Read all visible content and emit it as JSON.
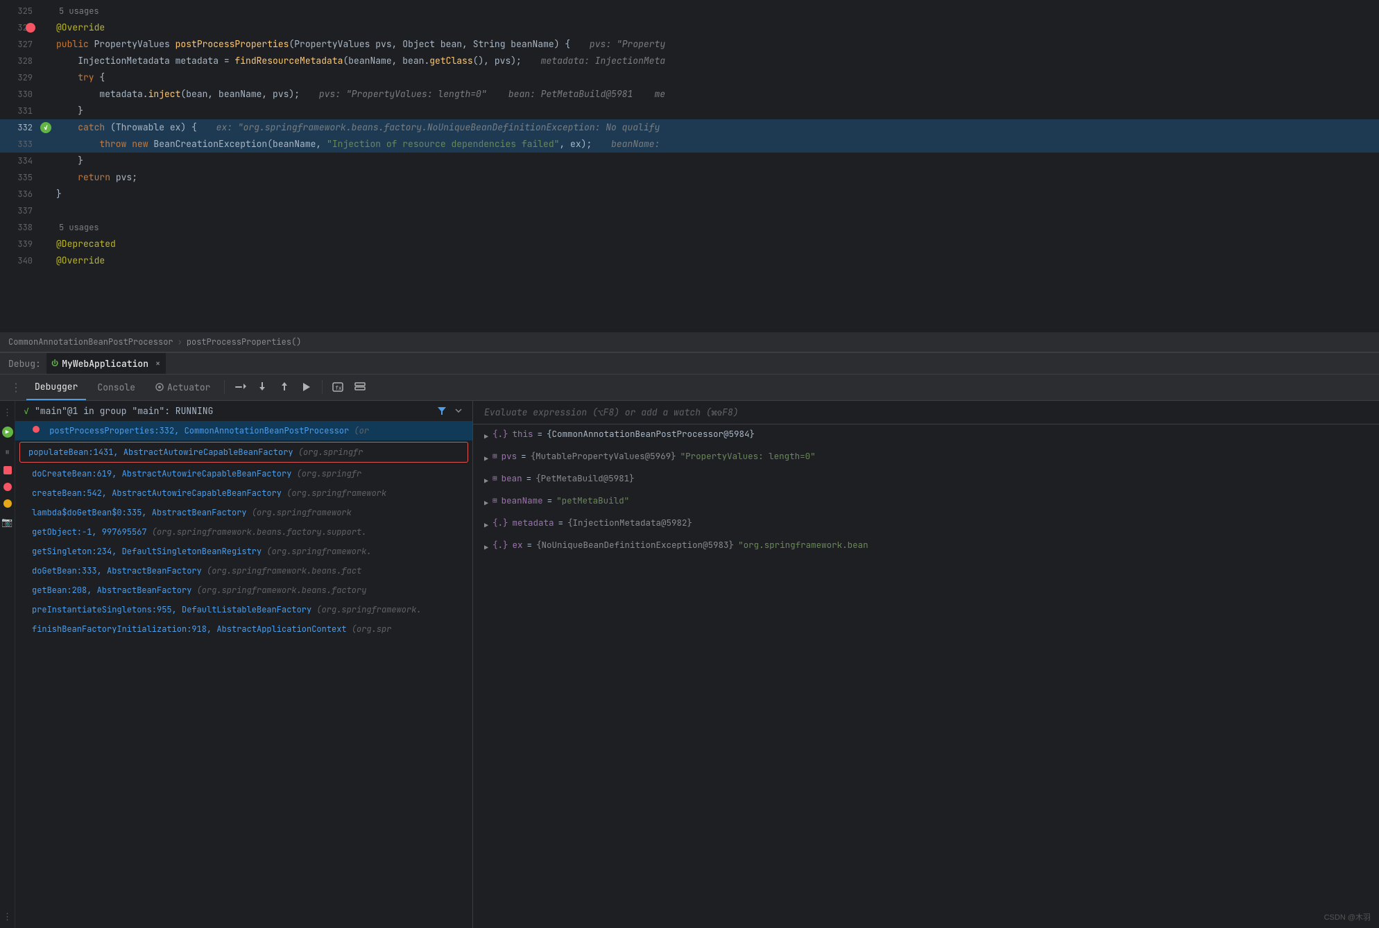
{
  "breadcrumb": {
    "class": "CommonAnnotationBeanPostProcessor",
    "method": "postProcessProperties()"
  },
  "debug_bar": {
    "label": "Debug:",
    "session": "MyWebApplication",
    "close": "×"
  },
  "tabs": {
    "debugger": "Debugger",
    "console": "Console",
    "actuator": "Actuator"
  },
  "thread": {
    "check": "✓",
    "name": "\"main\"@1 in group \"main\": RUNNING"
  },
  "eval_placeholder": "Evaluate expression (⌥F8) or add a watch (⌘⇧F8)",
  "frames": [
    {
      "method": "postProcessProperties:332,",
      "class": "CommonAnnotationBeanPostProcessor",
      "pkg": "(or",
      "active": true
    },
    {
      "method": "populateBean:1431,",
      "class": "AbstractAutowireCapableBeanFactory",
      "pkg": "(org.springfr",
      "selected_red": true
    },
    {
      "method": "doCreateBean:619,",
      "class": "AbstractAutowireCapableBeanFactory",
      "pkg": "(org.springfr"
    },
    {
      "method": "createBean:542,",
      "class": "AbstractAutowireCapableBeanFactory",
      "pkg": "(org.springframework"
    },
    {
      "method": "lambda$doGetBean$0:335,",
      "class": "AbstractBeanFactory",
      "pkg": "(org.springframework"
    },
    {
      "method": "getObject:-1, 997695567",
      "class": "",
      "pkg": "(org.springframework.beans.factory.support."
    },
    {
      "method": "getSingleton:234,",
      "class": "DefaultSingletonBeanRegistry",
      "pkg": "(org.springframework."
    },
    {
      "method": "doGetBean:333,",
      "class": "AbstractBeanFactory",
      "pkg": "(org.springframework.beans.fact"
    },
    {
      "method": "getBean:208,",
      "class": "AbstractBeanFactory",
      "pkg": "(org.springframework.beans.factory"
    },
    {
      "method": "preInstantiateSingletons:955,",
      "class": "DefaultListableBeanFactory",
      "pkg": "(org.springframework."
    },
    {
      "method": "finishBeanFactoryInitialization:918,",
      "class": "AbstractApplicationContext",
      "pkg": "(org.spr"
    }
  ],
  "variables": [
    {
      "type": "obj",
      "name": "this",
      "eq": "=",
      "value": "{CommonAnnotationBeanPostProcessor@5984}"
    },
    {
      "type": "ref",
      "name": "pvs",
      "eq": "=",
      "value": "{MutablePropertyValues@5969}",
      "extra": "\"PropertyValues: length=0\""
    },
    {
      "type": "ref",
      "name": "bean",
      "eq": "=",
      "value": "{PetMetaBuild@5981}"
    },
    {
      "type": "ref",
      "name": "beanName",
      "eq": "=",
      "value": "\"petMetaBuild\""
    },
    {
      "type": "obj",
      "name": "metadata",
      "eq": "=",
      "value": "{InjectionMetadata@5982}"
    },
    {
      "type": "obj",
      "name": "ex",
      "eq": "=",
      "value": "{NoUniqueBeanDefinitionException@5983}",
      "extra": "\"org.springframework.bean"
    }
  ],
  "code_lines": [
    {
      "num": "325",
      "content": "5 usages",
      "is_hint": true,
      "gutter": ""
    },
    {
      "num": "326",
      "content": "@Override",
      "annotation": true,
      "gutter": "bp_red",
      "inline_hint": ""
    },
    {
      "num": "327",
      "content": "public PropertyValues postProcessProperties(PropertyValues pvs, Object bean, String beanName) {",
      "gutter": "",
      "inline_hint": "pvs: \"Property"
    },
    {
      "num": "328",
      "content": "    InjectionMetadata metadata = findResourceMetadata(beanName, bean.getClass(), pvs);",
      "gutter": "",
      "inline_hint": "metadata: InjectionMeta"
    },
    {
      "num": "329",
      "content": "    try {",
      "gutter": ""
    },
    {
      "num": "330",
      "content": "        metadata.inject(bean, beanName, pvs);",
      "gutter": "",
      "inline_hint": "pvs: \"PropertyValues: length=0\"    bean: PetMetaBuild@5981    me"
    },
    {
      "num": "331",
      "content": "    }",
      "gutter": ""
    },
    {
      "num": "332",
      "content": "    catch (Throwable ex) {",
      "gutter": "exec_green",
      "highlighted": true,
      "inline_hint": "ex: \"org.springframework.beans.factory.NoUniqueBeanDefinitionException: No qualify"
    },
    {
      "num": "333",
      "content": "        throw new BeanCreationException(beanName, \"Injection of resource dependencies failed\", ex);",
      "gutter": "",
      "highlighted": true,
      "inline_hint": "beanName:"
    },
    {
      "num": "334",
      "content": "    }",
      "gutter": "",
      "highlighted": false
    },
    {
      "num": "335",
      "content": "    return pvs;",
      "gutter": ""
    },
    {
      "num": "336",
      "content": "}",
      "gutter": ""
    },
    {
      "num": "337",
      "content": "",
      "gutter": ""
    },
    {
      "num": "338",
      "content": "5 usages",
      "is_hint": true,
      "gutter": ""
    },
    {
      "num": "339",
      "content": "@Deprecated",
      "annotation": true,
      "gutter": ""
    },
    {
      "num": "340",
      "content": "@Override",
      "annotation": true,
      "gutter": ""
    }
  ],
  "toolbar_buttons": [
    {
      "icon": "↺",
      "title": "Rerun"
    },
    {
      "icon": "▶",
      "title": "Resume"
    },
    {
      "icon": "⏸",
      "title": "Pause"
    },
    {
      "icon": "⏹",
      "title": "Stop"
    },
    {
      "icon": "🔴",
      "title": "Toggle breakpoint"
    },
    {
      "icon": "🟡",
      "title": "Toggle mute"
    }
  ]
}
